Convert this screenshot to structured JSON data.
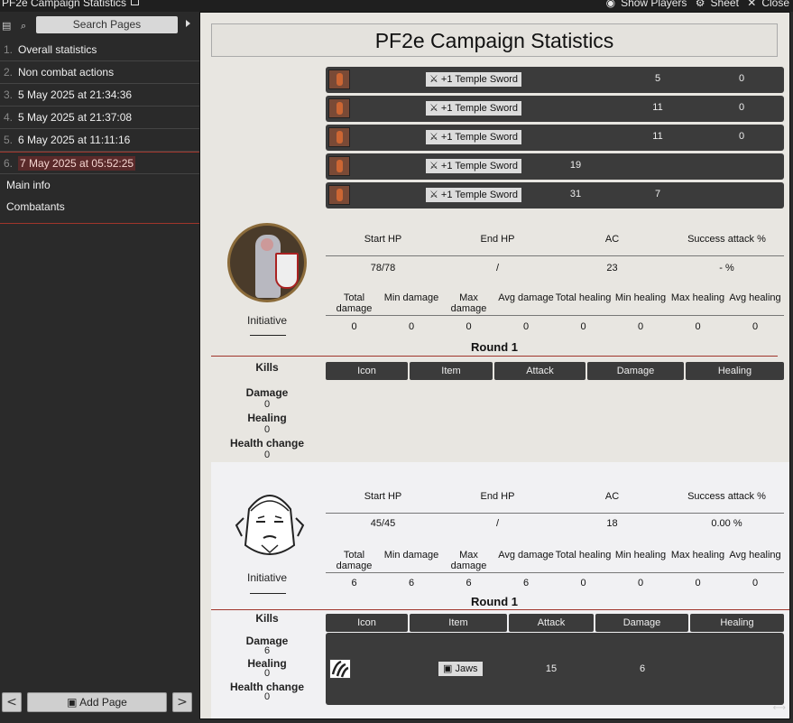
{
  "window": {
    "title": "PF2e Campaign Statistics",
    "actions": [
      "Show Players",
      "Sheet",
      "Close"
    ]
  },
  "sidebar": {
    "search_label": "Search Pages",
    "pages": [
      {
        "num": "1.",
        "label": "Overall statistics"
      },
      {
        "num": "2.",
        "label": "Non combat actions"
      },
      {
        "num": "3.",
        "label": "5 May 2025 at 21:34:36"
      },
      {
        "num": "4.",
        "label": "5 May 2025 at 21:37:08"
      },
      {
        "num": "5.",
        "label": "6 May 2025 at 11:11:16"
      },
      {
        "num": "6.",
        "label": "7 May 2025 at 05:52:25"
      }
    ],
    "sub_items": [
      "Main info",
      "Combatants"
    ],
    "add_page_label": "Add Page",
    "prev_label": "<",
    "next_label": ">"
  },
  "sheet": {
    "title": "PF2e Campaign Statistics",
    "attack_rows": [
      {
        "item": "+1 Temple Sword",
        "attack": "5",
        "damage": "0"
      },
      {
        "item": "+1 Temple Sword",
        "attack": "11",
        "damage": "0"
      },
      {
        "item": "+1 Temple Sword",
        "attack": "11",
        "damage": "0"
      },
      {
        "item": "+1 Temple Sword",
        "attack": "19",
        "damage": ""
      },
      {
        "item": "+1 Temple Sword",
        "attack": "31",
        "damage": "7"
      }
    ],
    "combatants": [
      {
        "initiative_label": "Initiative",
        "headers1": [
          "Start HP",
          "End HP",
          "AC",
          "Success attack %"
        ],
        "values1": [
          "78/78",
          "/",
          "23",
          "- %"
        ],
        "headers2": [
          "Total damage",
          "Min damage",
          "Max damage",
          "Avg damage",
          "Total healing",
          "Min healing",
          "Max healing",
          "Avg healing"
        ],
        "values2": [
          "0",
          "0",
          "0",
          "0",
          "0",
          "0",
          "0",
          "0"
        ],
        "round": "Round 1",
        "kills": "Kills",
        "damage_label": "Damage",
        "damage": "0",
        "healing_label": "Healing",
        "healing": "0",
        "health_change_label": "Health change",
        "health_change": "0",
        "table_headers": [
          "Icon",
          "Item",
          "Attack",
          "Damage",
          "Healing"
        ]
      },
      {
        "initiative_label": "Initiative",
        "headers1": [
          "Start HP",
          "End HP",
          "AC",
          "Success attack %"
        ],
        "values1": [
          "45/45",
          "/",
          "18",
          "0.00 %"
        ],
        "headers2": [
          "Total damage",
          "Min damage",
          "Max damage",
          "Avg damage",
          "Total healing",
          "Min healing",
          "Max healing",
          "Avg healing"
        ],
        "values2": [
          "6",
          "6",
          "6",
          "6",
          "0",
          "0",
          "0",
          "0"
        ],
        "round": "Round 1",
        "kills": "Kills",
        "damage_label": "Damage",
        "damage": "6",
        "healing_label": "Healing",
        "healing": "0",
        "health_change_label": "Health change",
        "health_change": "0",
        "table_headers": [
          "Icon",
          "Item",
          "Attack",
          "Damage",
          "Healing"
        ],
        "row": {
          "item": "Jaws",
          "attack": "15",
          "damage": "6"
        }
      }
    ]
  },
  "colors": {
    "accent_red": "#a0352b",
    "bar_dark": "#3b3b3b",
    "sidebar_bg": "#2a2a2a"
  }
}
